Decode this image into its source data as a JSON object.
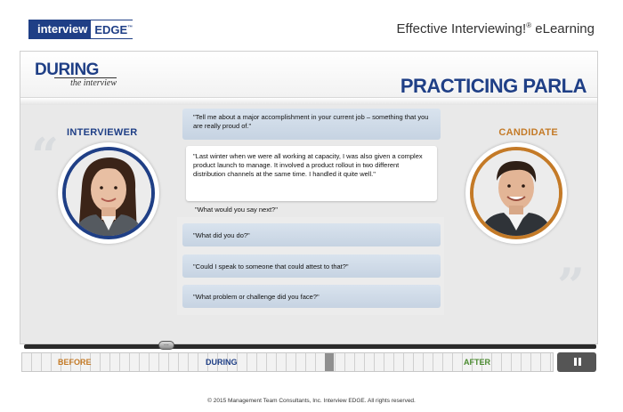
{
  "header": {
    "logo_left": "interview",
    "logo_right": "EDGE",
    "logo_tm": "™",
    "app_title": "Effective Interviewing!",
    "app_title_mark": "®",
    "app_title_suffix": " eLearning"
  },
  "stage": {
    "section_logo_big": "DURING",
    "section_logo_small": "the interview",
    "section_title": "PRACTICING PARLA",
    "roles": {
      "interviewer": "INTERVIEWER",
      "candidate": "CANDIDATE"
    },
    "dialogue": {
      "interviewer_line": "\"Tell me about a major accomplishment in your current job – something that you are really proud of.\"",
      "candidate_line": "\"Last winter when we were all working at capacity, I was also given a complex product launch to manage. It involved a product rollout in two different distribution channels at the same time. I handled it quite well.\"",
      "prompt": "\"What would you say next?\"",
      "options": [
        "\"What did you do?\"",
        "\"Could I speak to someone that could attest to that?\"",
        "\"What problem or challenge did you face?\""
      ]
    },
    "colors": {
      "interviewer": "#1f3f86",
      "candidate": "#c47a27"
    }
  },
  "player": {
    "seek_handle": "...",
    "timeline": {
      "before": "BEFORE",
      "during": "DURING",
      "after": "AFTER"
    },
    "pause_icon": "pause-icon"
  },
  "footer": "© 2015 Management Team Consultants, Inc. Interview EDGE. All rights reserved."
}
